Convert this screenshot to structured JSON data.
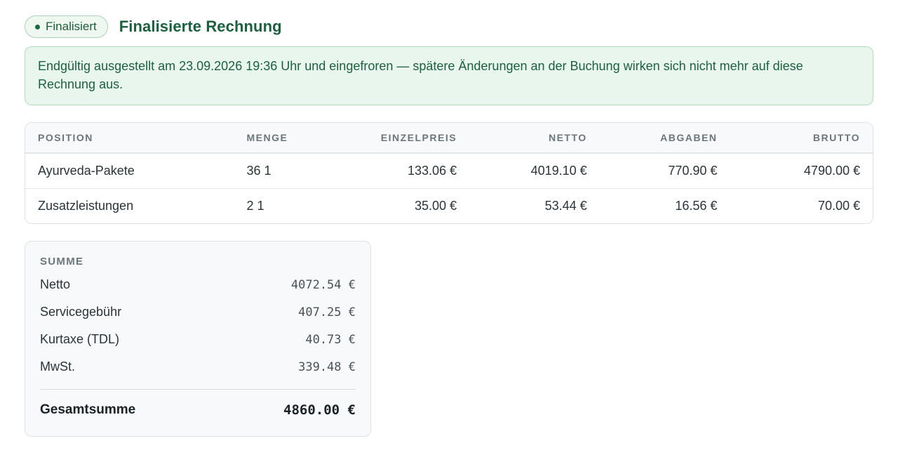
{
  "header": {
    "badge_label": "Finalisiert",
    "title": "Finalisierte Rechnung"
  },
  "notice": {
    "text": "Endgültig ausgestellt am 23.09.2026 19:36 Uhr und eingefroren — spätere Änderungen an der Buchung wirken sich nicht mehr auf diese Rechnung aus."
  },
  "table": {
    "columns": [
      "POSITION",
      "MENGE",
      "EINZELPREIS",
      "NETTO",
      "ABGABEN",
      "BRUTTO"
    ],
    "rows": [
      [
        "Ayurveda-Pakete",
        "36 1",
        "133.06 €",
        "4019.10 €",
        "770.90 €",
        "4790.00 €"
      ],
      [
        "Zusatzleistungen",
        "2 1",
        "35.00 €",
        "53.44 €",
        "16.56 €",
        "70.00 €"
      ]
    ]
  },
  "summary": {
    "title": "SUMME",
    "rows": [
      {
        "label": "Netto",
        "value": "4072.54 €"
      },
      {
        "label": "Servicegebühr",
        "value": "407.25 €"
      },
      {
        "label": "Kurtaxe (TDL)",
        "value": "40.73 €"
      },
      {
        "label": "MwSt.",
        "value": "339.48 €"
      }
    ],
    "total": {
      "label": "Gesamtsumme",
      "value": "4860.00 €"
    }
  },
  "colors": {
    "accent_green": "#1c6040",
    "notice_background": "#e9f6ee",
    "badge_background": "#eef8f1"
  }
}
